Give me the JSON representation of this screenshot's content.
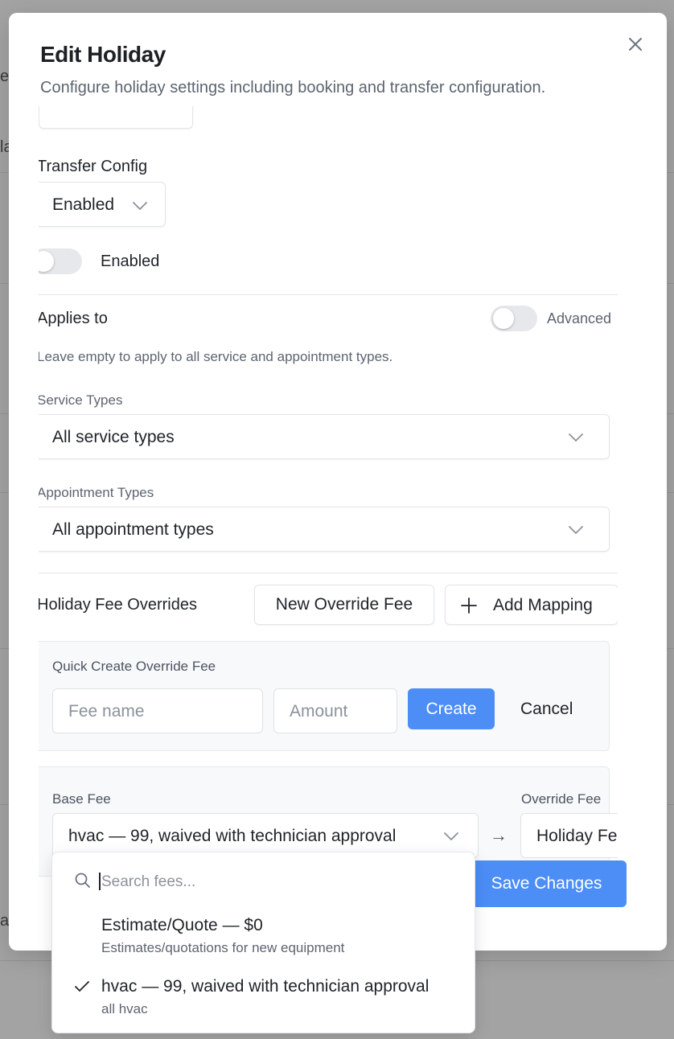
{
  "modal": {
    "title": "Edit Holiday",
    "subtitle": "Configure holiday settings including booking and transfer configuration."
  },
  "transfer_config": {
    "label": "Transfer Config",
    "selected": "Enabled",
    "toggle_label": "Enabled"
  },
  "applies_to": {
    "heading": "Applies to",
    "advanced_label": "Advanced",
    "hint": "Leave empty to apply to all service and appointment types.",
    "service_types_label": "Service Types",
    "service_types_value": "All service types",
    "appointment_types_label": "Appointment Types",
    "appointment_types_value": "All appointment types"
  },
  "fee_overrides": {
    "heading": "Holiday Fee Overrides",
    "new_override_label": "New Override Fee",
    "add_mapping_label": "Add Mapping",
    "quick_create": {
      "heading": "Quick Create Override Fee",
      "fee_name_placeholder": "Fee name",
      "amount_placeholder": "Amount",
      "create_label": "Create",
      "cancel_label": "Cancel"
    },
    "mapping": {
      "base_fee_label": "Base Fee",
      "base_fee_value": "hvac — 99, waived with technician approval",
      "arrow": "→",
      "override_fee_label": "Override Fee",
      "override_fee_value": "Holiday Fee"
    }
  },
  "dropdown": {
    "search_placeholder": "Search fees...",
    "items": [
      {
        "title": "Estimate/Quote — $0",
        "subtitle": "Estimates/quotations for new equipment",
        "selected": false
      },
      {
        "title": "hvac — 99, waived with technician approval",
        "subtitle": "all hvac",
        "selected": true
      }
    ]
  },
  "footer": {
    "save_label": "Save Changes"
  },
  "background": {
    "fragments": [
      "e",
      "la",
      "ay"
    ]
  },
  "colors": {
    "primary": "#4c8df6",
    "overlay": "#a3a3a3"
  }
}
